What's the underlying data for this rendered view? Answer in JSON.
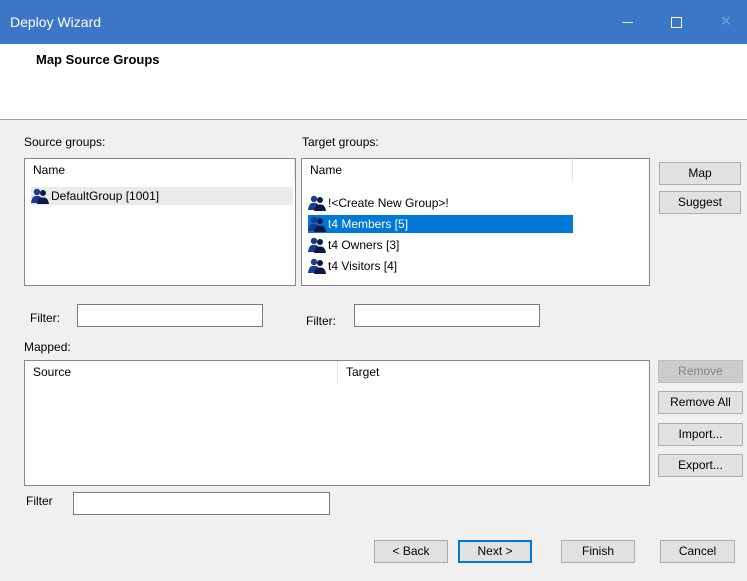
{
  "window": {
    "title": "Deploy Wizard",
    "minimize_glyph": "minimize-icon",
    "maximize_glyph": "maximize-icon",
    "close_glyph": "✕"
  },
  "header": {
    "title": "Map Source Groups"
  },
  "source": {
    "label": "Source groups:",
    "column": "Name",
    "items": [
      {
        "label": "DefaultGroup [1001]",
        "icon": "group-icon"
      }
    ]
  },
  "target": {
    "label": "Target groups:",
    "column": "Name",
    "items": [
      {
        "label": "!<Create New Group>!",
        "icon": "group-icon"
      },
      {
        "label": "t4 Members [5]",
        "icon": "group-icon",
        "selected": true
      },
      {
        "label": "t4 Owners [3]",
        "icon": "group-icon"
      },
      {
        "label": "t4 Visitors [4]",
        "icon": "group-icon"
      }
    ]
  },
  "side_buttons": {
    "map": "Map",
    "suggest": "Suggest"
  },
  "filters": {
    "source_label": "Filter:",
    "source_value": "",
    "target_label": "Filter:",
    "target_value": "",
    "mapped_label": "Filter",
    "mapped_value": ""
  },
  "mapped": {
    "label": "Mapped:",
    "columns": [
      "Source",
      "Target"
    ]
  },
  "mapped_buttons": {
    "remove": "Remove",
    "remove_all": "Remove All",
    "import": "Import...",
    "export": "Export..."
  },
  "footer": {
    "back": "< Back",
    "next": "Next >",
    "finish": "Finish",
    "cancel": "Cancel"
  },
  "colors": {
    "titlebar": "#3b76c9",
    "selection": "#0078d7",
    "background": "#f0f0f0"
  }
}
